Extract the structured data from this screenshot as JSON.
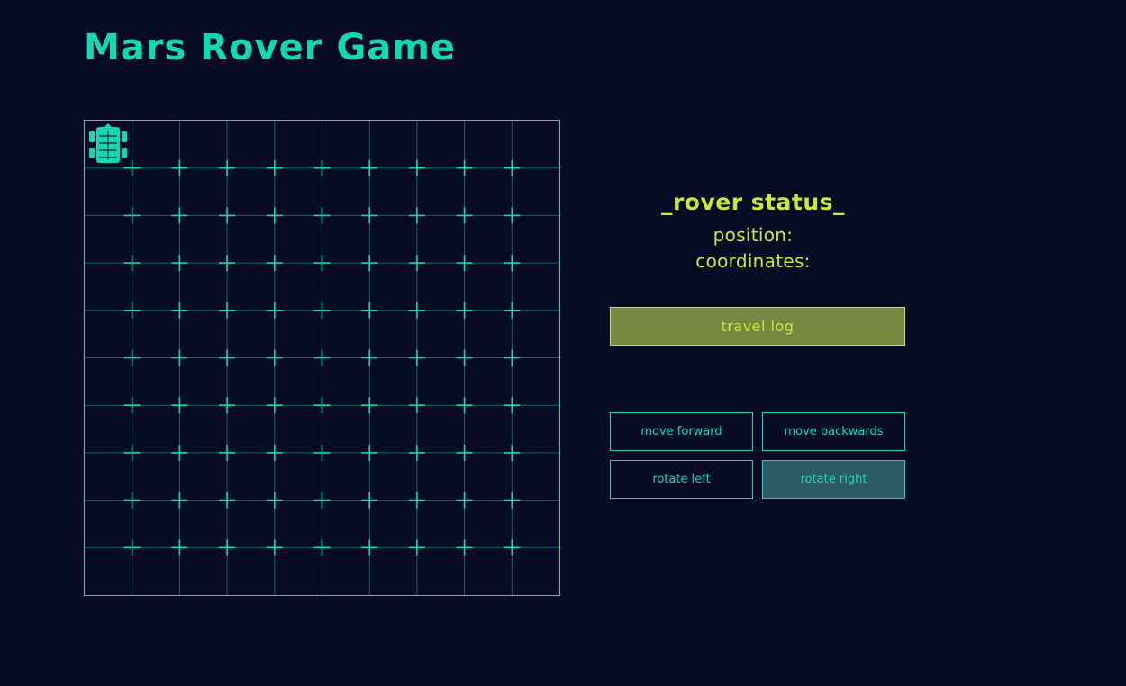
{
  "header": {
    "title": "Mars Rover Game"
  },
  "board": {
    "rows": 10,
    "cols": 10,
    "rover_position": {
      "row": 0,
      "col": 0
    },
    "rover_heading": "north"
  },
  "status": {
    "title": "_rover status_",
    "position_label": "position:",
    "coordinates_label": "coordinates:"
  },
  "buttons": {
    "travel_log": "travel log",
    "move_forward": "move forward",
    "move_backwards": "move backwards",
    "rotate_left": "rotate left",
    "rotate_right": "rotate right"
  },
  "colors": {
    "background": "#070c24",
    "accent": "#12d9b1",
    "status": "#c9e83c",
    "log_button": "#778640",
    "active_button": "#2c5b66"
  },
  "icons": {
    "rover": "rover-icon"
  }
}
